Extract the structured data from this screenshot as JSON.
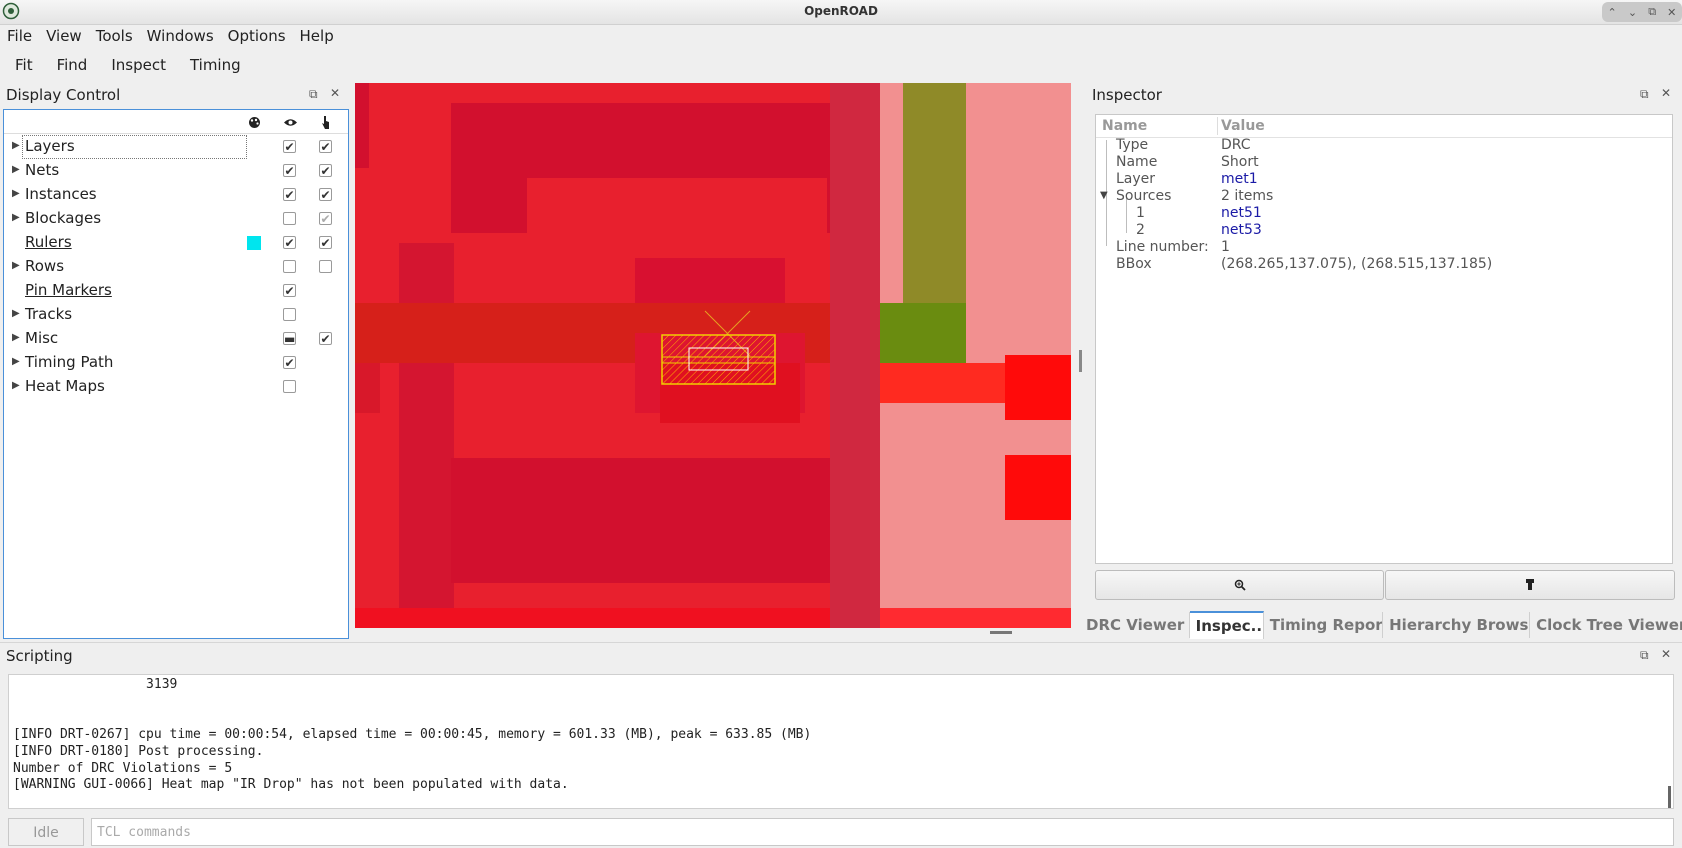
{
  "window": {
    "title": "OpenROAD",
    "controls": [
      "⌃",
      "⌄",
      "⧉",
      "✕"
    ]
  },
  "menubar": [
    "File",
    "View",
    "Tools",
    "Windows",
    "Options",
    "Help"
  ],
  "toolbar": [
    "Fit",
    "Find",
    "Inspect",
    "Timing"
  ],
  "display_control": {
    "title": "Display Control",
    "header_icons": [
      "palette-icon",
      "eye-icon",
      "pointer-icon"
    ],
    "items": [
      {
        "label": "Layers",
        "expandable": true,
        "underlined": false,
        "visible": "checked",
        "selectable": "checked"
      },
      {
        "label": "Nets",
        "expandable": true,
        "underlined": false,
        "visible": "checked",
        "selectable": "checked"
      },
      {
        "label": "Instances",
        "expandable": true,
        "underlined": false,
        "visible": "checked",
        "selectable": "checked"
      },
      {
        "label": "Blockages",
        "expandable": true,
        "underlined": false,
        "visible": "unchecked",
        "selectable": "checked-disabled"
      },
      {
        "label": "Rulers",
        "expandable": false,
        "underlined": true,
        "color": "#00e5ee",
        "visible": "checked",
        "selectable": "checked"
      },
      {
        "label": "Rows",
        "expandable": true,
        "underlined": false,
        "visible": "unchecked",
        "selectable": "unchecked"
      },
      {
        "label": "Pin Markers",
        "expandable": false,
        "underlined": true,
        "visible": "checked",
        "selectable": "none"
      },
      {
        "label": "Tracks",
        "expandable": true,
        "underlined": false,
        "visible": "unchecked",
        "selectable": "none"
      },
      {
        "label": "Misc",
        "expandable": true,
        "underlined": false,
        "visible": "partial",
        "selectable": "checked"
      },
      {
        "label": "Timing Path",
        "expandable": true,
        "underlined": false,
        "visible": "checked",
        "selectable": "none"
      },
      {
        "label": "Heat Maps",
        "expandable": true,
        "underlined": false,
        "visible": "unchecked",
        "selectable": "none"
      }
    ]
  },
  "inspector": {
    "title": "Inspector",
    "columns": [
      "Name",
      "Value"
    ],
    "rows": [
      {
        "name": "Type",
        "value": "DRC",
        "link": false,
        "depth": 0
      },
      {
        "name": "Name",
        "value": "Short",
        "link": false,
        "depth": 0
      },
      {
        "name": "Layer",
        "value": "met1",
        "link": true,
        "depth": 0
      },
      {
        "name": "Sources",
        "value": "2 items",
        "link": false,
        "depth": 0,
        "expanded": true
      },
      {
        "name": "1",
        "value": "net51",
        "link": true,
        "depth": 1
      },
      {
        "name": "2",
        "value": "net53",
        "link": true,
        "depth": 1
      },
      {
        "name": "Line number:",
        "value": "1",
        "link": false,
        "depth": 0
      },
      {
        "name": "BBox",
        "value": "(268.265,137.075), (268.515,137.185)",
        "link": false,
        "depth": 0
      }
    ],
    "buttons": [
      "zoom-in-icon",
      "flashlight-icon"
    ]
  },
  "tabs": [
    {
      "label": "DRC Viewer",
      "active": false
    },
    {
      "label": "Inspec...",
      "active": true
    },
    {
      "label": "Timing Report",
      "active": false
    },
    {
      "label": "Hierarchy Browser",
      "active": false
    },
    {
      "label": "Clock Tree Viewer",
      "active": false
    }
  ],
  "scripting": {
    "title": "Scripting",
    "output_lines": [
      "                 3139",
      "",
      "",
      "[INFO DRT-0267] cpu time = 00:00:54, elapsed time = 00:00:45, memory = 601.33 (MB), peak = 633.85 (MB)",
      "[INFO DRT-0180] Post processing.",
      "Number of DRC Violations = 5",
      "[WARNING GUI-0066] Heat map \"IR Drop\" has not been populated with data."
    ],
    "status": "Idle",
    "input_placeholder": "TCL commands"
  },
  "colors": {
    "met_red": "#e8202e",
    "dark_red": "#d2102e",
    "bright_red": "#ff1a10",
    "pink": "#f29090",
    "olive": "#8f8a28",
    "green": "#6a8c10",
    "drc_marker": "#f0d000",
    "ruler_cyan": "#00e5ee"
  }
}
